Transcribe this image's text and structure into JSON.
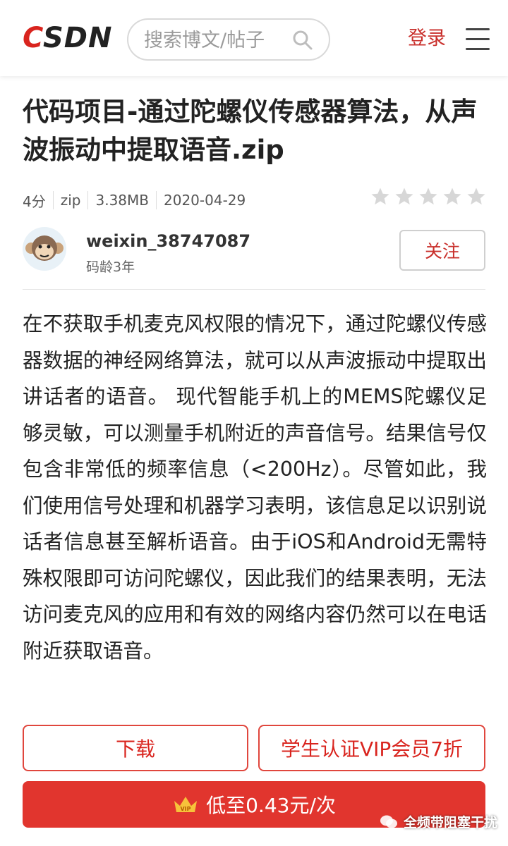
{
  "header": {
    "logo_text": "CSDN",
    "search_placeholder": "搜索博文/帖子",
    "login_label": "登录"
  },
  "resource": {
    "title": "代码项目-通过陀螺仪传感器算法，从声波振动中提取语音.zip",
    "points": "4分",
    "format": "zip",
    "size": "3.38MB",
    "date": "2020-04-29",
    "rating_stars": 0,
    "rating_max": 5
  },
  "author": {
    "name": "weixin_38747087",
    "code_age": "码龄3年",
    "follow_label": "关注"
  },
  "description": "在不获取手机麦克风权限的情况下，通过陀螺仪传感器数据的神经网络算法，就可以从声波振动中提取出讲话者的语音。 现代智能手机上的MEMS陀螺仪足够灵敏，可以测量手机附近的声音信号。结果信号仅包含非常低的频率信息（<200Hz）。尽管如此，我们使用信号处理和机器学习表明，该信息足以识别说话者信息甚至解析语音。由于iOS和Android无需特殊权限即可访问陀螺仪，因此我们的结果表明，无法访问麦克风的应用和有效的网络内容仍然可以在电话附近获取语音。",
  "actions": {
    "download_label": "下载",
    "vip_label": "学生认证VIP会员7折",
    "buy_label": "低至0.43元/次",
    "crown_text": "VIP"
  },
  "watermark": {
    "text": "全频带阻塞干扰"
  },
  "colors": {
    "brand_red": "#d9241e",
    "button_red": "#e1352e"
  }
}
